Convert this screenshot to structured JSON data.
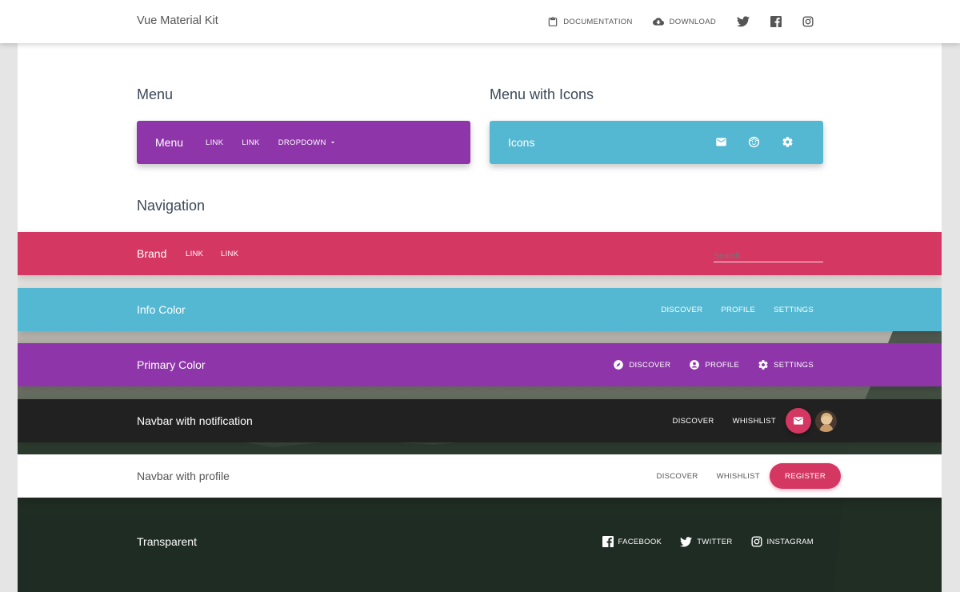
{
  "topbar": {
    "brand": "Vue Material Kit",
    "documentation": "DOCUMENTATION",
    "download": "DOWNLOAD",
    "icons": [
      "clipboard-icon",
      "cloud-download-icon",
      "twitter-icon",
      "facebook-icon",
      "instagram-icon"
    ]
  },
  "menu_section": {
    "heading": "Menu",
    "title": "Menu",
    "link1": "LINK",
    "link2": "LINK",
    "dropdown": "DROPDOWN",
    "color": "#8e35a9"
  },
  "icons_section": {
    "heading": "Menu with Icons",
    "title": "Icons",
    "icons": [
      "mail-icon",
      "face-icon",
      "settings-icon"
    ],
    "color": "#54b8d2"
  },
  "navigation": {
    "heading": "Navigation",
    "brand_bar": {
      "title": "Brand",
      "link1": "LINK",
      "link2": "LINK",
      "search_placeholder": "Search...",
      "color": "#d43762"
    },
    "info_bar": {
      "title": "Info Color",
      "discover": "DISCOVER",
      "profile": "PROFILE",
      "settings": "SETTINGS",
      "color": "#54b8d2"
    },
    "primary_bar": {
      "title": "Primary Color",
      "discover": "DISCOVER",
      "profile": "PROFILE",
      "settings": "SETTINGS",
      "icons": [
        "explore-icon",
        "account-circle-icon",
        "settings-icon"
      ],
      "color": "#8e35a9"
    },
    "notification_bar": {
      "title": "Navbar with notification",
      "discover": "DISCOVER",
      "wishlist": "WHISHLIST",
      "color": "#212121",
      "accent": "#d43762"
    },
    "profile_bar": {
      "title": "Navbar with profile",
      "discover": "DISCOVER",
      "wishlist": "WHISHLIST",
      "register": "REGISTER",
      "accent": "#d43762"
    },
    "transparent_bar": {
      "title": "Transparent",
      "facebook": "FACEBOOK",
      "twitter": "TWITTER",
      "instagram": "INSTAGRAM"
    }
  }
}
